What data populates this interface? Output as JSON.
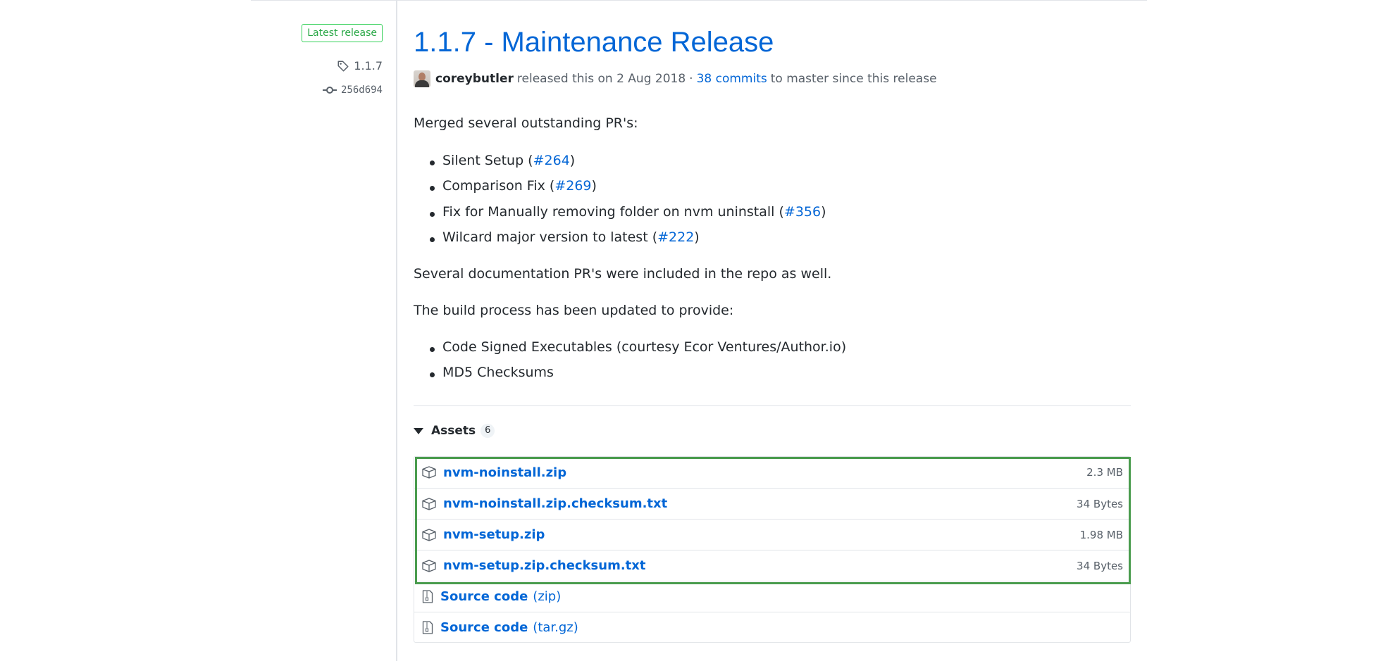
{
  "sidebar": {
    "latest_label": "Latest release",
    "tag": "1.1.7",
    "commit": "256d694"
  },
  "release": {
    "title": "1.1.7 - Maintenance Release",
    "author": "coreybutler",
    "released_text": "released this on 2 Aug 2018",
    "separator": "·",
    "commits_link": "38 commits",
    "commits_suffix": "to master since this release"
  },
  "notes": {
    "intro": "Merged several outstanding PR's:",
    "pr_items": [
      {
        "text": "Silent Setup (",
        "link": "#264",
        "close": ")"
      },
      {
        "text": "Comparison Fix (",
        "link": "#269",
        "close": ")"
      },
      {
        "text": "Fix for Manually removing folder on nvm uninstall (",
        "link": "#356",
        "close": ")"
      },
      {
        "text": "Wilcard major version to latest (",
        "link": "#222",
        "close": ")"
      }
    ],
    "docs_line": "Several documentation PR's were included in the repo as well.",
    "build_intro": "The build process has been updated to provide:",
    "build_items": [
      "Code Signed Executables (courtesy Ecor Ventures/Author.io)",
      "MD5 Checksums"
    ]
  },
  "assets": {
    "label": "Assets",
    "count": "6",
    "files": [
      {
        "name": "nvm-noinstall.zip",
        "size": "2.3 MB"
      },
      {
        "name": "nvm-noinstall.zip.checksum.txt",
        "size": "34 Bytes"
      },
      {
        "name": "nvm-setup.zip",
        "size": "1.98 MB"
      },
      {
        "name": "nvm-setup.zip.checksum.txt",
        "size": "34 Bytes"
      }
    ],
    "source": [
      {
        "name": "Source code",
        "suffix": "(zip)"
      },
      {
        "name": "Source code",
        "suffix": "(tar.gz)"
      }
    ]
  },
  "colors": {
    "link": "#0366d6",
    "latest_badge": "#28a745",
    "highlight_border": "#4a9c4e"
  },
  "icons": {
    "tag": "tag-icon",
    "commit": "git-commit-icon",
    "package": "package-icon",
    "archive": "file-zip-icon",
    "disclosure": "triangle-down-icon"
  }
}
